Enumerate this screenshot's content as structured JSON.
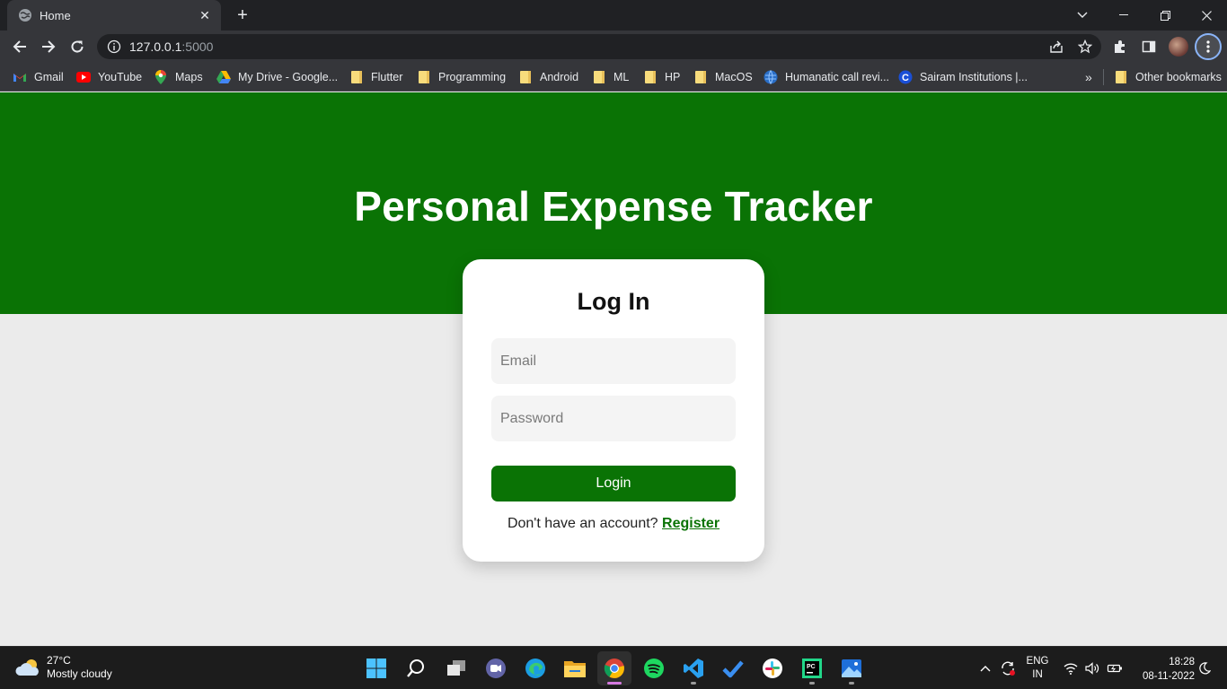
{
  "browser": {
    "tab_title": "Home",
    "url_host": "127.0.0.1",
    "url_port": ":5000",
    "bookmarks": [
      {
        "label": "Gmail",
        "icon": "gmail-icon"
      },
      {
        "label": "YouTube",
        "icon": "youtube-icon"
      },
      {
        "label": "Maps",
        "icon": "maps-icon"
      },
      {
        "label": "My Drive - Google...",
        "icon": "drive-icon"
      },
      {
        "label": "Flutter",
        "icon": "folder-icon"
      },
      {
        "label": "Programming",
        "icon": "folder-icon"
      },
      {
        "label": "Android",
        "icon": "folder-icon"
      },
      {
        "label": "ML",
        "icon": "folder-icon"
      },
      {
        "label": "HP",
        "icon": "folder-icon"
      },
      {
        "label": "MacOS",
        "icon": "folder-icon"
      },
      {
        "label": "Humanatic call revi...",
        "icon": "globe-icon"
      },
      {
        "label": "Sairam Institutions |...",
        "icon": "sairam-icon"
      }
    ],
    "overflow_label": "»",
    "other_bookmarks": "Other bookmarks"
  },
  "page": {
    "heading": "Personal Expense Tracker",
    "card_title": "Log In",
    "email_placeholder": "Email",
    "password_placeholder": "Password",
    "login_button": "Login",
    "register_prompt": "Don't have an account? ",
    "register_link": "Register",
    "brand_color": "#0a7305"
  },
  "taskbar": {
    "temperature": "27°C",
    "weather": "Mostly cloudy",
    "language_top": "ENG",
    "language_bottom": "IN",
    "time": "18:28",
    "date": "08-11-2022"
  }
}
